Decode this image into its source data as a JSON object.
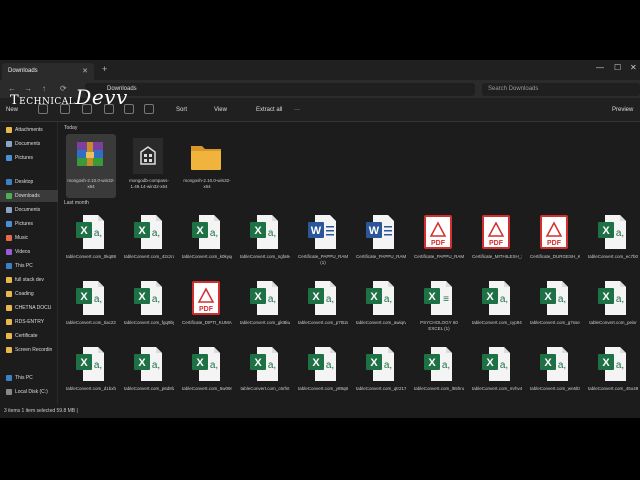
{
  "tab": {
    "title": "Downloads",
    "close": "✕",
    "new": "+"
  },
  "window_controls": {
    "min": "—",
    "max": "☐",
    "close": "✕"
  },
  "address": {
    "path": "Downloads",
    "search_placeholder": "Search Downloads",
    "back": "←",
    "forward": "→",
    "up": "↑",
    "refresh": "⟳"
  },
  "toolbar": {
    "new_label": "New",
    "sort_label": "Sort",
    "view_label": "View",
    "extract_label": "Extract all",
    "more_label": "···",
    "preview_label": "Preview"
  },
  "watermark": {
    "part1": "Technical",
    "part2": "Devv"
  },
  "sidebar": {
    "items": [
      {
        "label": "Attachments",
        "color": "#e8b84a"
      },
      {
        "label": "Documents",
        "color": "#8aa4c8"
      },
      {
        "label": "Pictures",
        "color": "#4a90d9"
      },
      {
        "label": "Desktop",
        "color": "#3b82c4"
      },
      {
        "label": "Downloads",
        "color": "#4caf50"
      },
      {
        "label": "Documents",
        "color": "#8aa4c8"
      },
      {
        "label": "Pictures",
        "color": "#4a90d9"
      },
      {
        "label": "Music",
        "color": "#e86a4a"
      },
      {
        "label": "Videos",
        "color": "#9c5ad9"
      },
      {
        "label": "This PC",
        "color": "#3b82c4"
      },
      {
        "label": "full stack dev",
        "color": "#e8b84a"
      },
      {
        "label": "Coading",
        "color": "#e8b84a"
      },
      {
        "label": "CHETNA DOCU",
        "color": "#e8b84a"
      },
      {
        "label": "RDS-ENTRY",
        "color": "#e8b84a"
      },
      {
        "label": "Certificate",
        "color": "#e8b84a"
      },
      {
        "label": "Screen Recordin",
        "color": "#e8b84a"
      },
      {
        "label": "This PC",
        "color": "#3b82c4"
      },
      {
        "label": "Local Disk (C:)",
        "color": "#888888"
      }
    ]
  },
  "groups": {
    "today": "Today",
    "last_month": "Last month"
  },
  "today_files": [
    {
      "name": "mongosh-2.10.0-win32-x64",
      "kind": "rar"
    },
    {
      "name": "mongodb-compass-1.49.14-win32-x64",
      "kind": "app"
    },
    {
      "name": "mongosh-2.10.0-win32-x64",
      "kind": "folder"
    }
  ],
  "month_files": [
    {
      "name": "tableConvert.com_0kq88z",
      "kind": "excel"
    },
    {
      "name": "tableConvert.com_42czrd",
      "kind": "excel"
    },
    {
      "name": "tableConvert.com_k0kyqg",
      "kind": "excel"
    },
    {
      "name": "tableConvert.com_ngfa94",
      "kind": "excel"
    },
    {
      "name": "Certificate_PAPPU_RAM01 (1)",
      "kind": "word"
    },
    {
      "name": "Certificate_PAPPU_RAM01",
      "kind": "word"
    },
    {
      "name": "Certificate_PAPPU_RAM01",
      "kind": "pdf"
    },
    {
      "name": "Certificate_MITHILESH_SAHU01",
      "kind": "pdf"
    },
    {
      "name": "Certificate_DURGESH_KUMAR01",
      "kind": "pdf"
    },
    {
      "name": "tableConvert.com_ec7b0y",
      "kind": "excel"
    },
    {
      "name": "tableConvert.com_tiac22",
      "kind": "excel"
    },
    {
      "name": "tableConvert.com_fgq9by",
      "kind": "excel"
    },
    {
      "name": "Certificate_DIPTI_KUMARI",
      "kind": "pdf"
    },
    {
      "name": "tableConvert.com_gkt8iw",
      "kind": "excel"
    },
    {
      "name": "tableConvert.com_p7t52d",
      "kind": "excel"
    },
    {
      "name": "tableConvert.com_awiqrv",
      "kind": "excel"
    },
    {
      "name": "PSYCHOLOGY 60 EXCEL (1)",
      "kind": "sheet"
    },
    {
      "name": "tableConvert.com_cyp944",
      "kind": "excel"
    },
    {
      "name": "tableConvert.com_g7sse8",
      "kind": "excel"
    },
    {
      "name": "tableConvert.com_peisr",
      "kind": "excel"
    },
    {
      "name": "tableConvert.com_d1bxhj",
      "kind": "excel"
    },
    {
      "name": "tableConvert.com_p6d8lz",
      "kind": "excel"
    },
    {
      "name": "tableConvert.com_5w09m5",
      "kind": "excel"
    },
    {
      "name": "tableConvert.com_c6rfnt",
      "kind": "excel"
    },
    {
      "name": "tableConvert.com_y89q8z",
      "kind": "excel"
    },
    {
      "name": "tableConvert.com_qtr217",
      "kind": "excel"
    },
    {
      "name": "tableConvert.com_l55hnq",
      "kind": "excel"
    },
    {
      "name": "tableConvert.com_mrhv42",
      "kind": "excel"
    },
    {
      "name": "tableConvert.com_wn6lt3",
      "kind": "excel"
    },
    {
      "name": "tableConvert.com_45o498",
      "kind": "excel"
    }
  ],
  "status": {
    "text": "3 items   1 item selected  59.8 MB  |"
  },
  "colors": {
    "excel": "#1e7145",
    "word": "#2b579a",
    "pdf": "#d32f2f",
    "folder": "#f0b43c"
  }
}
